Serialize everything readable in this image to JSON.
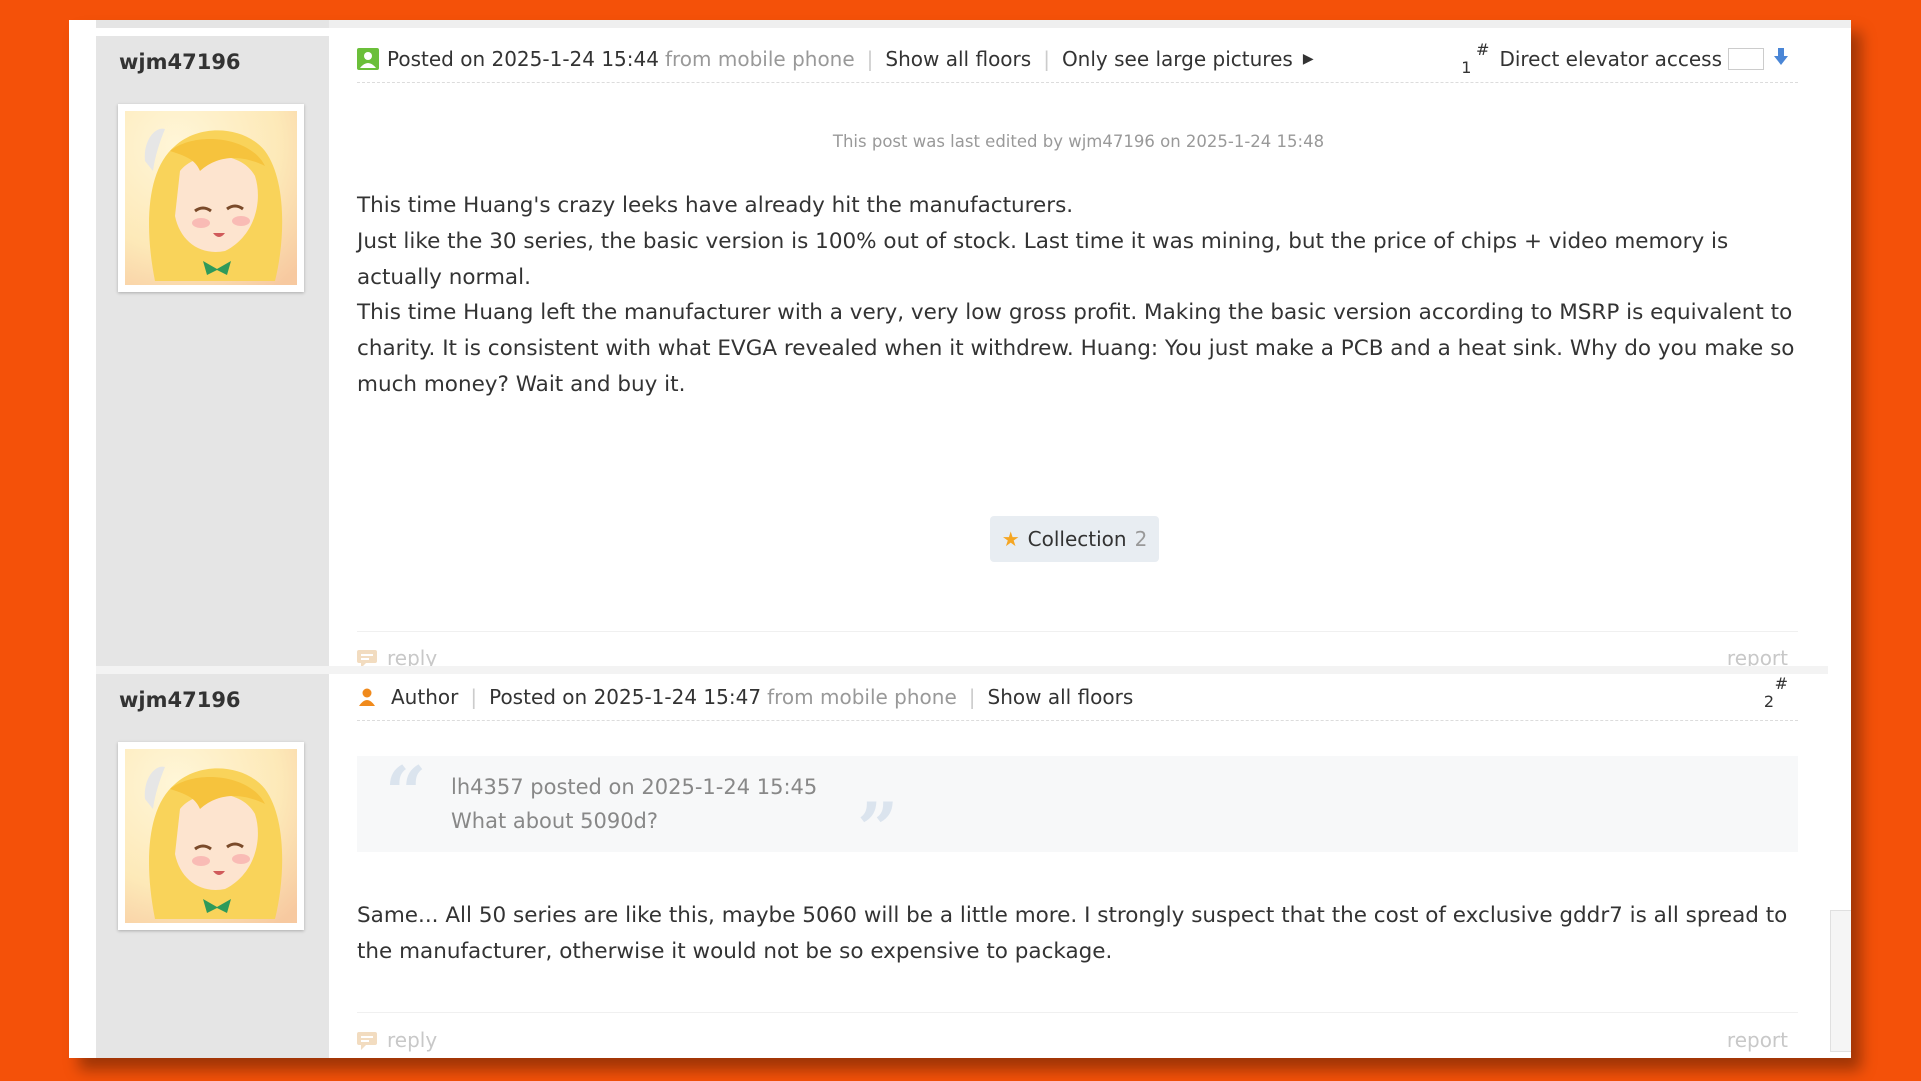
{
  "posts": [
    {
      "username": "wjm47196",
      "posted": "Posted on 2025-1-24 15:44",
      "source": "from mobile phone",
      "show_all_floors": "Show all floors",
      "only_large": "Only see large pictures",
      "floor_hash": "#",
      "floor_num": "1",
      "elevator_label": "Direct elevator access",
      "edited_note": "This post was last edited by wjm47196 on 2025-1-24 15:48",
      "paragraphs": [
        "This time Huang's crazy leeks have already hit the manufacturers.",
        "Just like the 30 series, the basic version is 100% out of stock. Last time it was mining, but the price of chips + video memory is actually normal.",
        "This time Huang left the manufacturer with a very, very low gross profit. Making the basic version according to MSRP is equivalent to charity. It is consistent with what EVGA revealed when it withdrew. Huang: You just make a PCB and a heat sink. Why do you make so much money? Wait and buy it."
      ],
      "collection_label": "Collection",
      "collection_count": "2",
      "reply": "reply",
      "report": "report"
    },
    {
      "username": "wjm47196",
      "author": "Author",
      "posted": "Posted on 2025-1-24 15:47",
      "source": "from mobile phone",
      "show_all_floors": "Show all floors",
      "floor_hash": "#",
      "floor_num": "2",
      "quote_header": "lh4357 posted on 2025-1-24 15:45",
      "quote_text": "What about 5090d?",
      "paragraphs": [
        "Same... All 50 series are like this, maybe 5060 will be a little more. I strongly suspect that the cost of exclusive gddr7 is all spread to the manufacturer, otherwise it would not be so expensive to package."
      ],
      "reply": "reply",
      "report": "report"
    }
  ],
  "colors": {
    "background": "#f45109",
    "sidebar": "#e5e5e5",
    "muted_text": "#999999",
    "author_icon": "#f08a1c",
    "star": "#f5a623",
    "elevator_arrow": "#4a86d6"
  },
  "icons": [
    "avatar-badge-icon",
    "triangle-right-icon",
    "down-arrow-icon",
    "star-icon",
    "person-icon",
    "reply-icon",
    "open-quote-icon",
    "close-quote-icon"
  ]
}
